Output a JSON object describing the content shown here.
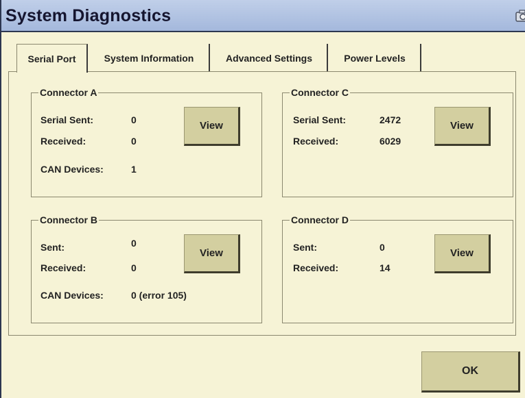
{
  "window": {
    "title": "System Diagnostics"
  },
  "tabs": [
    {
      "label": "Serial Port",
      "active": true
    },
    {
      "label": "System Information",
      "active": false
    },
    {
      "label": "Advanced Settings",
      "active": false
    },
    {
      "label": "Power Levels",
      "active": false
    }
  ],
  "connectors": {
    "a": {
      "title": "Connector A",
      "rows": [
        {
          "label": "Serial Sent:",
          "value": "0"
        },
        {
          "label": "Received:",
          "value": "0"
        },
        {
          "label": "CAN Devices:",
          "value": "1"
        }
      ],
      "view_label": "View"
    },
    "b": {
      "title": "Connector B",
      "rows": [
        {
          "label": "Sent:",
          "value": "0"
        },
        {
          "label": "Received:",
          "value": "0"
        },
        {
          "label": "CAN Devices:",
          "value": "0 (error 105)"
        }
      ],
      "view_label": "View"
    },
    "c": {
      "title": "Connector C",
      "rows": [
        {
          "label": "Serial Sent:",
          "value": "2472"
        },
        {
          "label": "Received:",
          "value": "6029"
        }
      ],
      "view_label": "View"
    },
    "d": {
      "title": "Connector D",
      "rows": [
        {
          "label": "Sent:",
          "value": "0"
        },
        {
          "label": "Received:",
          "value": "14"
        }
      ],
      "view_label": "View"
    }
  },
  "footer": {
    "ok_label": "OK"
  },
  "icons": {
    "title_icon": "camera-icon"
  },
  "colors": {
    "titlebar": "#b3c4e4",
    "background": "#f6f3d6",
    "button": "#d3cfa0",
    "border_dark": "#2c3650"
  }
}
